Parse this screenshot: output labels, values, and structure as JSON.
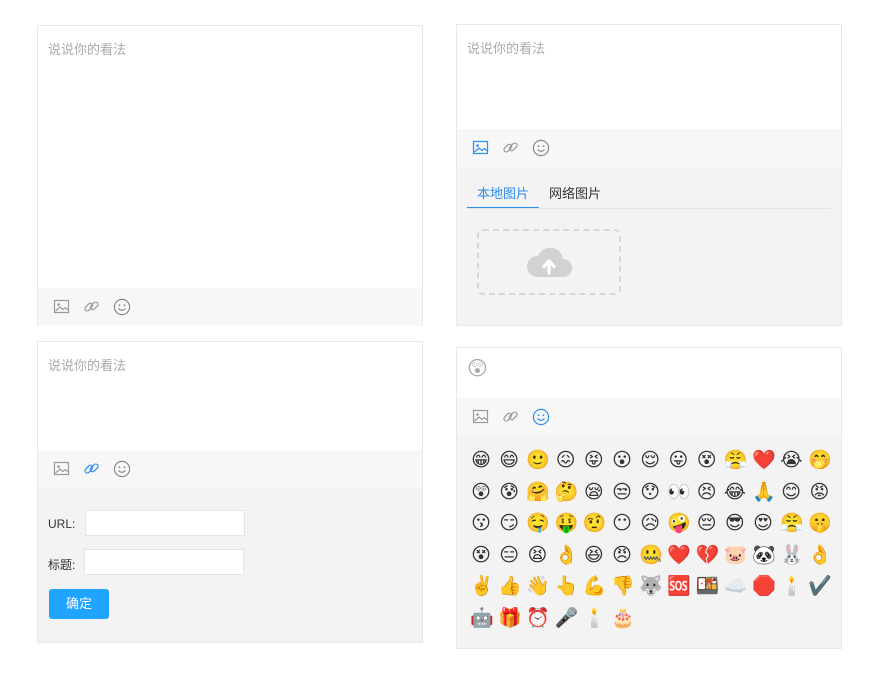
{
  "editor": {
    "placeholder": "说说你的看法"
  },
  "toolbar": {
    "image_icon": "image-icon",
    "link_icon": "link-icon",
    "emoji_icon": "smile-icon",
    "accent": "#2d8cf0",
    "muted": "#999999"
  },
  "image_panel": {
    "tabs": [
      "本地图片",
      "网络图片"
    ],
    "active_tab": 0,
    "upload_icon": "cloud-upload-icon"
  },
  "link_panel": {
    "url_label": "URL:",
    "title_label": "标题:",
    "url_value": "",
    "title_value": "",
    "confirm_label": "确定"
  },
  "emoji_panel": {
    "selected": "😲",
    "rows": [
      [
        "😁",
        "😄",
        "🙂",
        "😖",
        "😝",
        "😮",
        "😌",
        "😛",
        "😵",
        "😤",
        "❤️",
        "😭",
        "🤭"
      ],
      [
        "😲",
        "😰",
        "🤗",
        "🤔",
        "😪",
        "😒",
        "😯",
        "👀",
        "😣",
        "😂",
        "🙏",
        "😊",
        "😡"
      ],
      [
        "😗",
        "😏",
        "🤤",
        "🤑",
        "🤨",
        "😶",
        "😥",
        "🤪",
        "😔",
        "😎",
        "😍",
        "😤",
        "🤫"
      ],
      [
        "😵",
        "😑",
        "😫",
        "👌",
        "😆",
        "😠",
        "🤐",
        "❤️",
        "💔",
        "🐷",
        "🐼",
        "🐰",
        "👌"
      ],
      [
        "✌️",
        "👍",
        "👋",
        "👆",
        "💪",
        "👎",
        "🐺",
        "🆘",
        "🍱",
        "☁️",
        "🛑",
        "🕯️",
        "✔️"
      ],
      [
        "🤖",
        "🎁",
        "⏰",
        "🎤",
        "🕯️",
        "🎂"
      ]
    ]
  }
}
